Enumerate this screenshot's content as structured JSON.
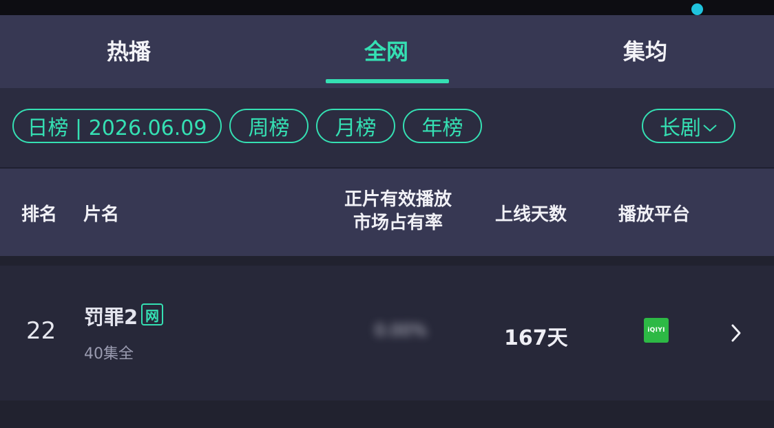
{
  "tabs": [
    {
      "label": "热播",
      "active": false
    },
    {
      "label": "全网",
      "active": true
    },
    {
      "label": "集均",
      "active": false
    }
  ],
  "filters": {
    "daily": "日榜 | 2026.06.09",
    "weekly": "周榜",
    "monthly": "月榜",
    "yearly": "年榜",
    "category": "长剧"
  },
  "table_header": {
    "rank": "排名",
    "name": "片名",
    "share_line1": "正片有效播放",
    "share_line2": "市场占有率",
    "days": "上线天数",
    "platform": "播放平台"
  },
  "rows": [
    {
      "rank": "22",
      "title": "罚罪2",
      "badge": "网",
      "episodes": "40集全",
      "share": "0.00%",
      "days": "167天",
      "platform_logo": "iQIYI"
    }
  ],
  "colors": {
    "accent": "#35e0b3",
    "tab_bar": "#373853",
    "background": "#272839",
    "platform_green": "#2db945"
  }
}
